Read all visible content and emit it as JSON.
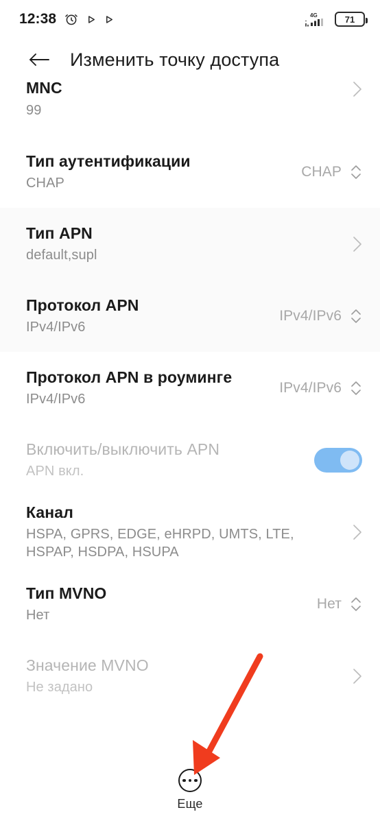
{
  "status_bar": {
    "time": "12:38",
    "battery_percent": "71",
    "network_label": "4G",
    "icons": [
      "alarm-clock-icon",
      "play-triangle-icon",
      "play-triangle-icon",
      "signal-4g-icon",
      "battery-icon"
    ]
  },
  "app_bar": {
    "back_label": "back-arrow-icon",
    "title": "Изменить точку доступа"
  },
  "rows": [
    {
      "title": "MNC",
      "subtitle": "99",
      "value": "",
      "accessory": "chevron-right-icon",
      "clipped": true,
      "shaded": false,
      "disabled": false
    },
    {
      "title": "Тип аутентификации",
      "subtitle": "CHAP",
      "value": "CHAP",
      "accessory": "spinner-icon",
      "clipped": false,
      "shaded": false,
      "disabled": false
    },
    {
      "title": "Тип APN",
      "subtitle": "default,supl",
      "value": "",
      "accessory": "chevron-right-icon",
      "clipped": false,
      "shaded": true,
      "disabled": false
    },
    {
      "title": "Протокол APN",
      "subtitle": "IPv4/IPv6",
      "value": "IPv4/IPv6",
      "accessory": "spinner-icon",
      "clipped": false,
      "shaded": true,
      "disabled": false
    },
    {
      "title": "Протокол APN в роуминге",
      "subtitle": "IPv4/IPv6",
      "value": "IPv4/IPv6",
      "accessory": "spinner-icon",
      "clipped": false,
      "shaded": false,
      "disabled": false
    },
    {
      "title": "Включить/выключить APN",
      "subtitle": "APN вкл.",
      "value": "",
      "accessory": "toggle-on",
      "clipped": false,
      "shaded": false,
      "disabled": true
    },
    {
      "title": "Канал",
      "subtitle": "HSPA, GPRS, EDGE, eHRPD, UMTS, LTE, HSPAP, HSDPA, HSUPA",
      "value": "",
      "accessory": "chevron-right-icon",
      "clipped": false,
      "shaded": false,
      "disabled": false
    },
    {
      "title": "Тип MVNO",
      "subtitle": "Нет",
      "value": "Нет",
      "accessory": "spinner-icon",
      "clipped": false,
      "shaded": false,
      "disabled": false
    },
    {
      "title": "Значение MVNO",
      "subtitle": "Не задано",
      "value": "",
      "accessory": "chevron-right-icon",
      "clipped": false,
      "shaded": false,
      "disabled": true
    }
  ],
  "bottom_bar": {
    "more_label": "Еще",
    "more_icon": "more-dots-icon"
  },
  "annotation": {
    "arrow_color": "#F03C1E",
    "points_to": "Еще"
  },
  "colors": {
    "toggle_on": "#7fbbf2",
    "toggle_knob": "#cfe4fa",
    "title_text": "#1b1b1b",
    "secondary_text": "#8c8c8c",
    "disabled_text": "#b5b5b5",
    "shaded_row_bg": "#fafafa",
    "page_bg": "#ffffff"
  }
}
